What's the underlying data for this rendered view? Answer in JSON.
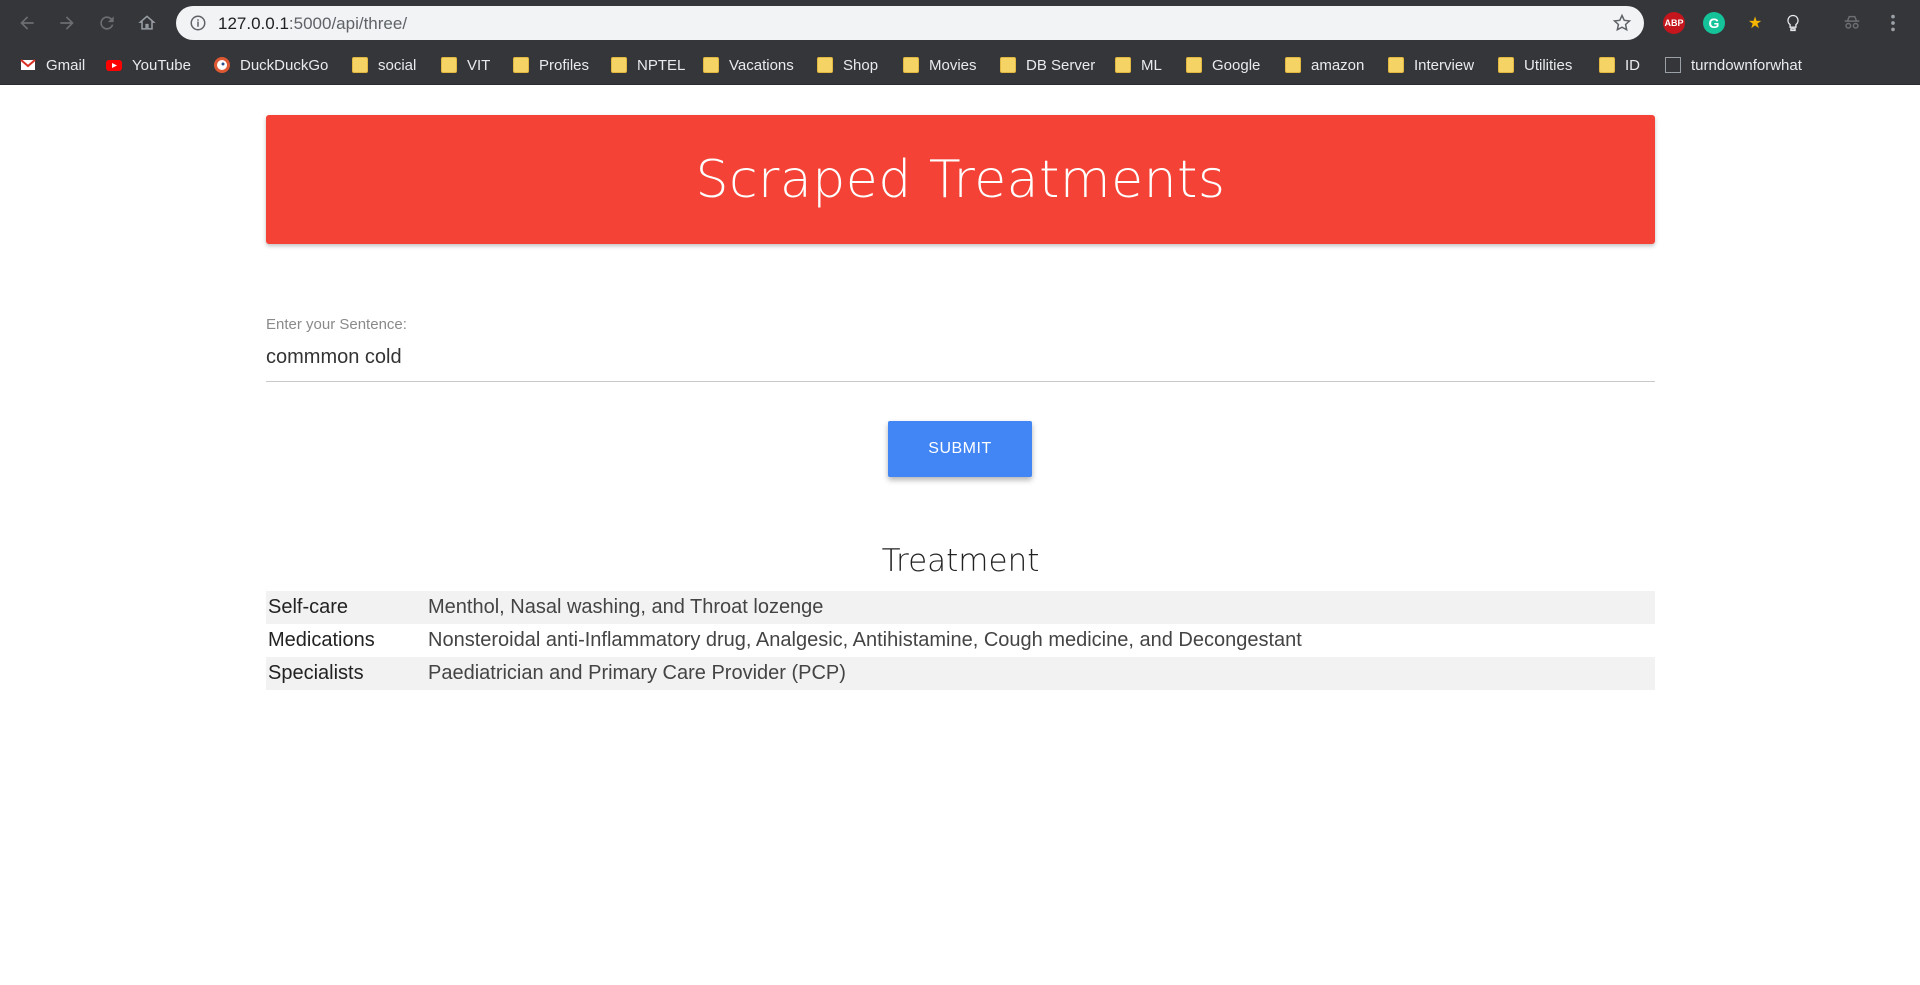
{
  "browser": {
    "url_host": "127.0.0.1",
    "url_rest": ":5000/api/three/",
    "extensions": {
      "abp": "ABP",
      "grammarly": "G"
    },
    "bookmarks": [
      {
        "label": "Gmail",
        "icon": "gmail-icon"
      },
      {
        "label": "YouTube",
        "icon": "youtube-icon"
      },
      {
        "label": "DuckDuckGo",
        "icon": "duckduckgo-icon"
      },
      {
        "label": "social",
        "icon": "folder-icon"
      },
      {
        "label": "VIT",
        "icon": "folder-icon"
      },
      {
        "label": "Profiles",
        "icon": "folder-icon"
      },
      {
        "label": "NPTEL",
        "icon": "folder-icon"
      },
      {
        "label": "Vacations",
        "icon": "folder-icon"
      },
      {
        "label": "Shop",
        "icon": "folder-icon"
      },
      {
        "label": "Movies",
        "icon": "folder-icon"
      },
      {
        "label": "DB Server",
        "icon": "folder-icon"
      },
      {
        "label": "ML",
        "icon": "folder-icon"
      },
      {
        "label": "Google",
        "icon": "folder-icon"
      },
      {
        "label": "amazon",
        "icon": "folder-icon"
      },
      {
        "label": "Interview",
        "icon": "folder-icon"
      },
      {
        "label": "Utilities",
        "icon": "folder-icon"
      },
      {
        "label": "ID",
        "icon": "folder-icon"
      },
      {
        "label": "turndownforwhat",
        "icon": "page-icon"
      }
    ]
  },
  "page": {
    "header_title": "Scraped Treatments",
    "header_color": "#f44336",
    "input_label": "Enter your Sentence:",
    "input_value": "commmon cold",
    "submit_label": "SUBMIT",
    "submit_color": "#4285f4",
    "section_title": "Treatment",
    "rows": [
      {
        "key": "Self-care",
        "value": "Menthol, Nasal washing, and Throat lozenge"
      },
      {
        "key": "Medications",
        "value": "Nonsteroidal anti-Inflammatory drug, Analgesic, Antihistamine, Cough medicine, and Decongestant"
      },
      {
        "key": "Specialists",
        "value": "Paediatrician and Primary Care Provider (PCP)"
      }
    ]
  }
}
